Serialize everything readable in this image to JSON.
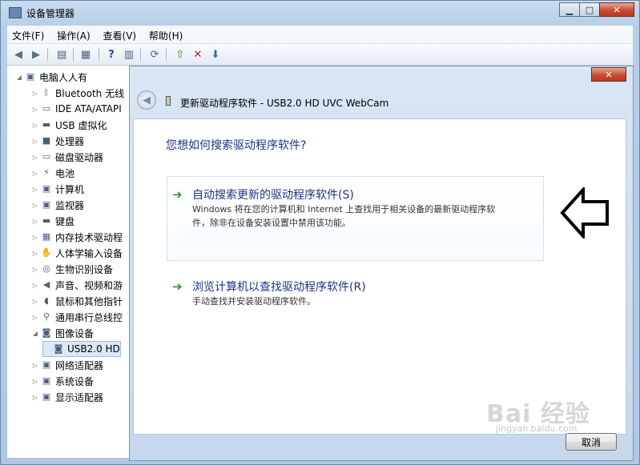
{
  "window": {
    "title": "设备管理器"
  },
  "menu": [
    "文件(F)",
    "操作(A)",
    "查看(V)",
    "帮助(H)"
  ],
  "tree": {
    "root": "电脑人人有",
    "items": [
      {
        "label": "Bluetooth 无线",
        "icon": "bluetooth-icon",
        "glyph": "ᛒ"
      },
      {
        "label": "IDE ATA/ATAPI",
        "icon": "ide-controller-icon",
        "glyph": "▭"
      },
      {
        "label": "USB 虚拟化",
        "icon": "usb-icon",
        "glyph": "▬"
      },
      {
        "label": "处理器",
        "icon": "processor-icon",
        "glyph": "■"
      },
      {
        "label": "磁盘驱动器",
        "icon": "disk-drive-icon",
        "glyph": "▭"
      },
      {
        "label": "电池",
        "icon": "battery-icon",
        "glyph": "⚡"
      },
      {
        "label": "计算机",
        "icon": "computer-icon",
        "glyph": "▣"
      },
      {
        "label": "监视器",
        "icon": "monitor-icon",
        "glyph": "▣"
      },
      {
        "label": "键盘",
        "icon": "keyboard-icon",
        "glyph": "▬"
      },
      {
        "label": "内存技术驱动程",
        "icon": "memory-icon",
        "glyph": "▦"
      },
      {
        "label": "人体学输入设备",
        "icon": "hid-icon",
        "glyph": "✋"
      },
      {
        "label": "生物识别设备",
        "icon": "fingerprint-icon",
        "glyph": "◎"
      },
      {
        "label": "声音、视频和游",
        "icon": "sound-icon",
        "glyph": "◀"
      },
      {
        "label": "鼠标和其他指针",
        "icon": "mouse-icon",
        "glyph": "◖"
      },
      {
        "label": "通用串行总线控",
        "icon": "usb-controller-icon",
        "glyph": "⚲"
      },
      {
        "label": "图像设备",
        "icon": "imaging-device-icon",
        "glyph": "◙"
      },
      {
        "label": "USB2.0 HD",
        "icon": "webcam-icon",
        "glyph": "◙"
      },
      {
        "label": "网络适配器",
        "icon": "network-icon",
        "glyph": "▣"
      },
      {
        "label": "系统设备",
        "icon": "system-device-icon",
        "glyph": "▣"
      },
      {
        "label": "显示适配器",
        "icon": "display-adapter-icon",
        "glyph": "▣"
      }
    ]
  },
  "dialog": {
    "title": "更新驱动程序软件 - USB2.0 HD UVC WebCam",
    "question": "您想如何搜索驱动程序软件?",
    "option1": {
      "title": "自动搜索更新的驱动程序软件(S)",
      "desc_line1": "Windows 将在您的计算机和 Internet 上查找用于相关设备的最新驱动程序软",
      "desc_line2": "件，除非在设备安装设置中禁用该功能。"
    },
    "option2": {
      "title": "浏览计算机以查找驱动程序软件(R)",
      "desc": "手动查找并安装驱动程序软件。"
    },
    "cancel_label": "取消"
  },
  "watermark": {
    "main": "Bai  经验",
    "sub": "jingyan.baidu.com"
  }
}
